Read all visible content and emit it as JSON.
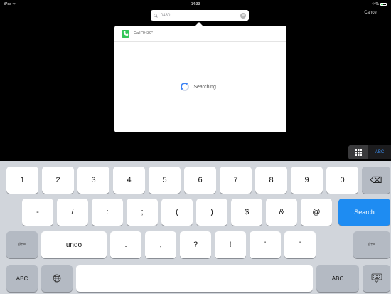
{
  "status_bar": {
    "carrier": "iPad ᯤ",
    "time": "14:33",
    "battery": "44%"
  },
  "search": {
    "query": "0430",
    "clear_icon": "⊗",
    "cancel_label": "Cancel"
  },
  "results": {
    "call_label": "Call “0430”",
    "searching_label": "Searching..."
  },
  "keyboard_mode": {
    "abc_label": "ABC"
  },
  "keyboard": {
    "row1": [
      "1",
      "2",
      "3",
      "4",
      "5",
      "6",
      "7",
      "8",
      "9",
      "0"
    ],
    "backspace_icon": "⌫",
    "row2": [
      "-",
      "/",
      ":",
      ";",
      "(",
      ")",
      "$",
      "&",
      "@"
    ],
    "search_label": "Search",
    "row3": [
      "undo",
      ".",
      ",",
      "?",
      "!",
      "'",
      "\""
    ],
    "symbols_label": "#+=",
    "abc_label": "ABC"
  },
  "colors": {
    "accent": "#1e8cf2",
    "call_green": "#34c759",
    "keyboard_bg": "#d1d5db"
  }
}
